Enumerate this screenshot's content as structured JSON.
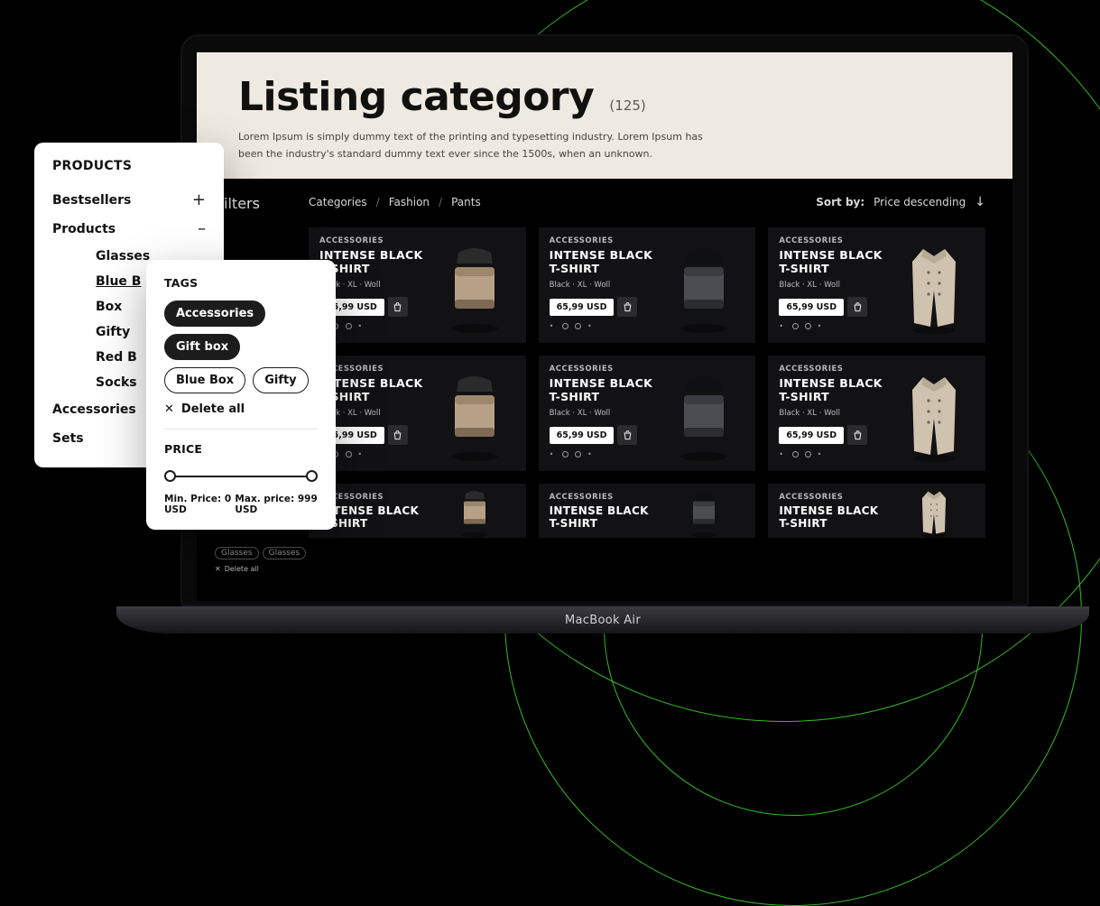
{
  "deco": {},
  "laptop": {
    "model": "MacBook Air"
  },
  "hero": {
    "title": "Listing category",
    "count": "(125)",
    "subtitle": "Lorem Ipsum is simply dummy text of the printing and typesetting industry. Lorem Ipsum has been the industry's standard dummy text ever since the 1500s, when an unknown."
  },
  "filters_label": "Filters",
  "breadcrumbs": [
    "Categories",
    "Fashion",
    "Pants"
  ],
  "sort": {
    "label": "Sort by:",
    "value": "Price descending",
    "arrow": "↓"
  },
  "bg_tags": {
    "items": [
      "Glasses",
      "Glasses"
    ],
    "delete": "Delete all"
  },
  "card_template": {
    "category": "ACCESSORIES",
    "name": "INTENSE BLACK T-SHIRT",
    "attrs": "Black  ·  XL  ·  Woll",
    "price": "65,99 USD"
  },
  "rows": 3,
  "cols": 3,
  "sidebar": {
    "title": "PRODUCTS",
    "items": [
      {
        "label": "Bestsellers",
        "expand": "+"
      },
      {
        "label": "Products",
        "expand": "–",
        "children": [
          "Glasses",
          "Blue Box",
          "Box",
          "Gifty",
          "Red Box",
          "Socks"
        ],
        "active_child": 1
      },
      {
        "label": "Accessories"
      },
      {
        "label": "Sets"
      }
    ]
  },
  "tags": {
    "title": "TAGS",
    "chips": [
      {
        "label": "Accessories",
        "on": true
      },
      {
        "label": "Gift box",
        "on": true
      },
      {
        "label": "Blue Box",
        "on": false
      },
      {
        "label": "Gifty",
        "on": false
      }
    ],
    "delete_all": "Delete all",
    "price_title": "PRICE",
    "min": "Min. Price: 0 USD",
    "max": "Max. price: 999 USD"
  }
}
